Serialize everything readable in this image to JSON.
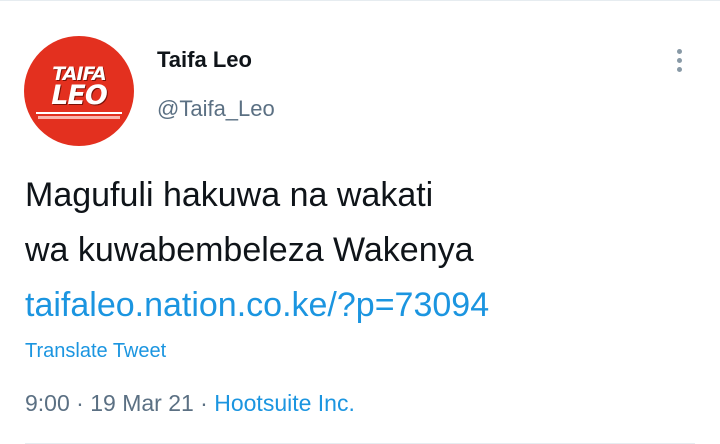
{
  "tweet": {
    "author": {
      "display_name": "Taifa Leo",
      "handle": "@Taifa_Leo",
      "avatar_logo_top": "TAIFA",
      "avatar_logo_bottom": "LEO",
      "avatar_color": "#e3301f"
    },
    "text_lines": [
      "Magufuli hakuwa na wakati",
      "wa kuwabembeleza Wakenya"
    ],
    "link": "taifaleo.nation.co.ke/?p=73094",
    "translate_label": "Translate Tweet",
    "time": "9:00",
    "separator": " · ",
    "date": "19 Mar 21",
    "source": "Hootsuite Inc."
  },
  "icons": {
    "more_menu": "more-vertical-icon"
  },
  "colors": {
    "link": "#1b95e0",
    "secondary_text": "#5b7083",
    "primary_text": "#0f1419",
    "border": "#e6ecf0"
  }
}
